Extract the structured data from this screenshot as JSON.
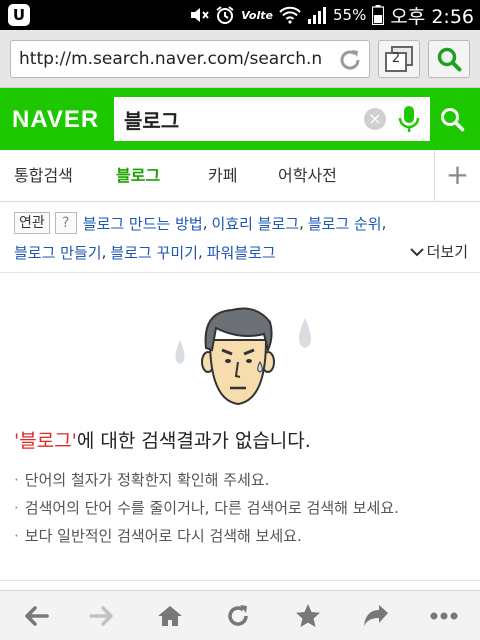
{
  "status_bar": {
    "battery": "55%",
    "time": "오후 2:56",
    "network": "Volte"
  },
  "url_bar": {
    "url": "http://m.search.naver.com/search.naver?where=m_blog",
    "tab_count": "2"
  },
  "naver": {
    "logo": "NAVER",
    "query": "블로그",
    "brand_color": "#1ec800"
  },
  "tabs": [
    {
      "label": "통합검색"
    },
    {
      "label": "블로그"
    },
    {
      "label": "카페"
    },
    {
      "label": "어학사전"
    }
  ],
  "related": {
    "label": "연관",
    "help": "?",
    "links": [
      "블로그 만드는 방법",
      "이효리 블로그",
      "블로그 순위",
      "블로그 만들기",
      "블로그 꾸미기",
      "파워블로그"
    ],
    "separator": ",",
    "more_label": "더보기"
  },
  "result": {
    "keyword": "'블로그'",
    "message": "에 대한 검색결과가 없습니다.",
    "tips": [
      "단어의 철자가 정확한지 확인해 주세요.",
      "검색어의 단어 수를 줄이거나, 다른 검색어로 검색해 보세요.",
      "보다 일반적인 검색어로 다시 검색해 보세요."
    ],
    "bullet": "·"
  },
  "icons": {
    "back": "arrow-left-icon",
    "forward": "arrow-right-icon",
    "home": "home-icon",
    "reload": "reload-icon",
    "bookmark": "star-icon",
    "share": "share-icon",
    "menu": "more-icon"
  }
}
